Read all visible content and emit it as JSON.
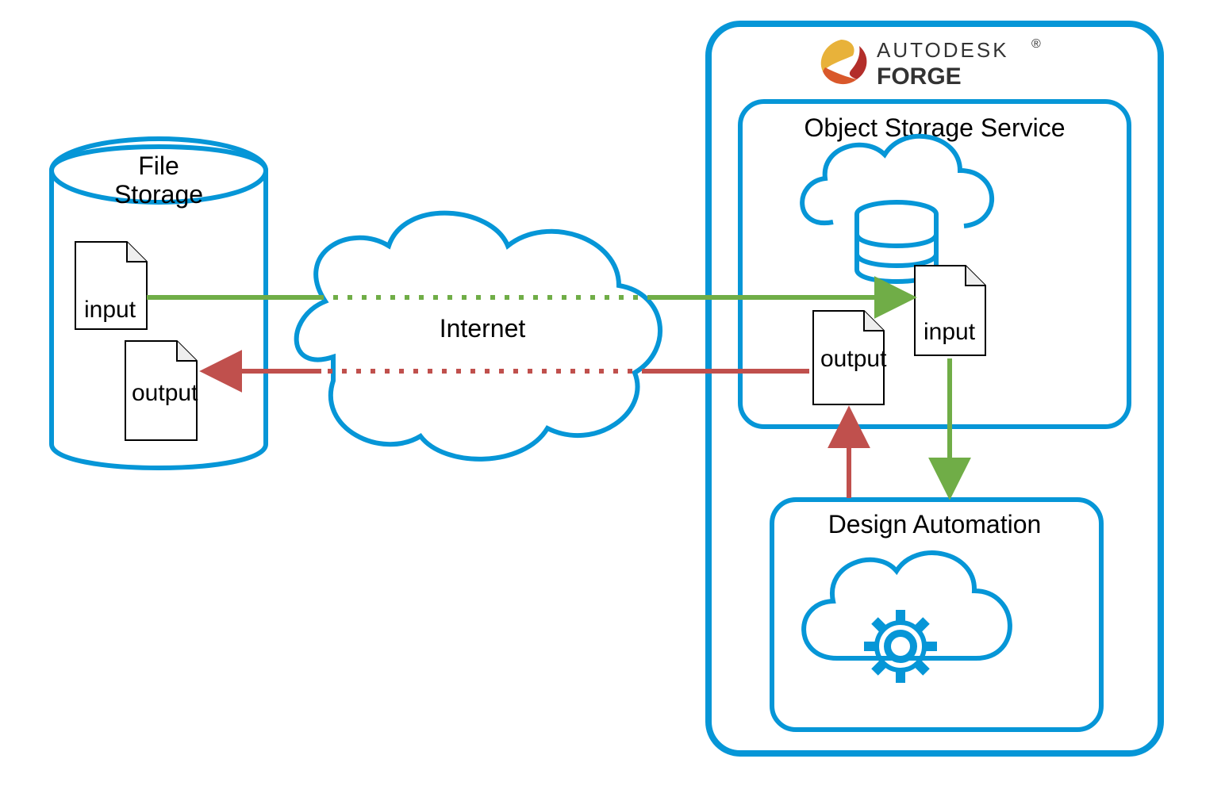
{
  "fileStorage": {
    "title_line1": "File",
    "title_line2": "Storage",
    "inputLabel": "input",
    "outputLabel": "output"
  },
  "internet": {
    "label": "Internet"
  },
  "forge": {
    "brandTop": "AUTODESK",
    "brandBottom": "FORGE",
    "oss": {
      "title": "Object Storage Service",
      "inputLabel": "input",
      "outputLabel": "output"
    },
    "da": {
      "title": "Design Automation"
    }
  },
  "colors": {
    "blue": "#0696D7",
    "green": "#70AD47",
    "red": "#C0504D",
    "black": "#000000"
  }
}
